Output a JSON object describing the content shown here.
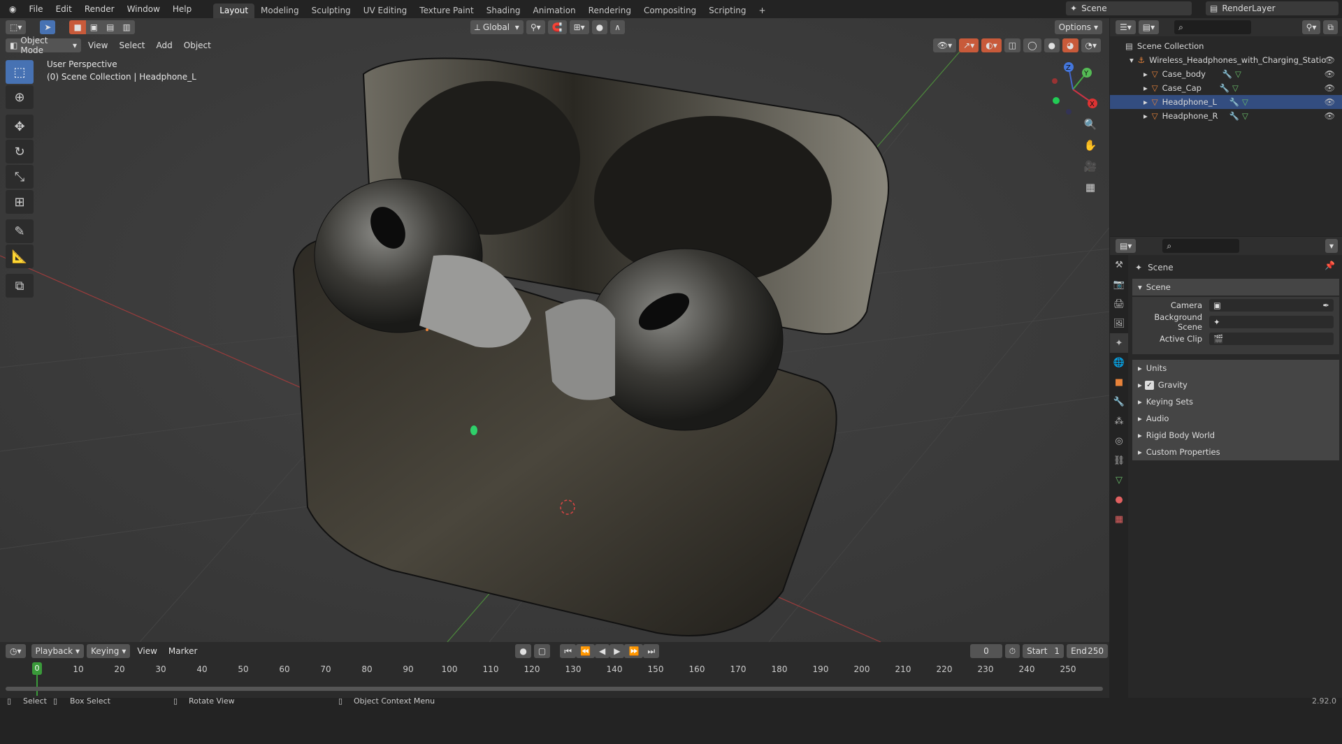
{
  "menu": [
    "File",
    "Edit",
    "Render",
    "Window",
    "Help"
  ],
  "workspaces": [
    "Layout",
    "Modeling",
    "Sculpting",
    "UV Editing",
    "Texture Paint",
    "Shading",
    "Animation",
    "Rendering",
    "Compositing",
    "Scripting"
  ],
  "workspace_active": "Layout",
  "add_workspace_icon": "+",
  "scene_name": "Scene",
  "render_layer": "RenderLayer",
  "viewport": {
    "mode": "Object Mode",
    "menu": [
      "View",
      "Select",
      "Add",
      "Object"
    ],
    "orientation": "Global",
    "options_label": "Options",
    "perspective_label": "User Perspective",
    "collection_label": "(0) Scene Collection | Headphone_L"
  },
  "gizmo": {
    "x": "X",
    "y": "Y",
    "z": "Z"
  },
  "outliner": {
    "root": "Scene Collection",
    "collection": "Wireless_Headphones_with_Charging_Statio",
    "objects": [
      "Case_body",
      "Case_Cap",
      "Headphone_L",
      "Headphone_R"
    ],
    "active_object": "Headphone_L"
  },
  "properties": {
    "header": "Scene",
    "panel_title": "Scene",
    "fields": [
      {
        "label": "Camera",
        "icon": "camera-icon"
      },
      {
        "label": "Background Scene",
        "icon": "scene-icon"
      },
      {
        "label": "Active Clip",
        "icon": "clip-icon"
      }
    ],
    "subpanels": [
      "Units",
      "Gravity",
      "Keying Sets",
      "Audio",
      "Rigid Body World",
      "Custom Properties"
    ],
    "gravity_checked": true
  },
  "timeline": {
    "menu": [
      "Playback",
      "Keying",
      "View",
      "Marker"
    ],
    "current_frame": "0",
    "start_label": "Start",
    "start": "1",
    "end_label": "End",
    "end": "250",
    "ticks": [
      "0",
      "10",
      "20",
      "30",
      "40",
      "50",
      "60",
      "70",
      "80",
      "90",
      "100",
      "110",
      "120",
      "130",
      "140",
      "150",
      "160",
      "170",
      "180",
      "190",
      "200",
      "210",
      "220",
      "230",
      "240",
      "250"
    ],
    "playhead": "0"
  },
  "status": {
    "select": "Select",
    "box_select": "Box Select",
    "rotate_view": "Rotate View",
    "context_menu": "Object Context Menu",
    "version": "2.92.0"
  },
  "colors": {
    "accent": "#4772b3",
    "active_tab": "#3d3d3d",
    "playhead": "#3a9a3a",
    "orange": "#e8833a"
  }
}
